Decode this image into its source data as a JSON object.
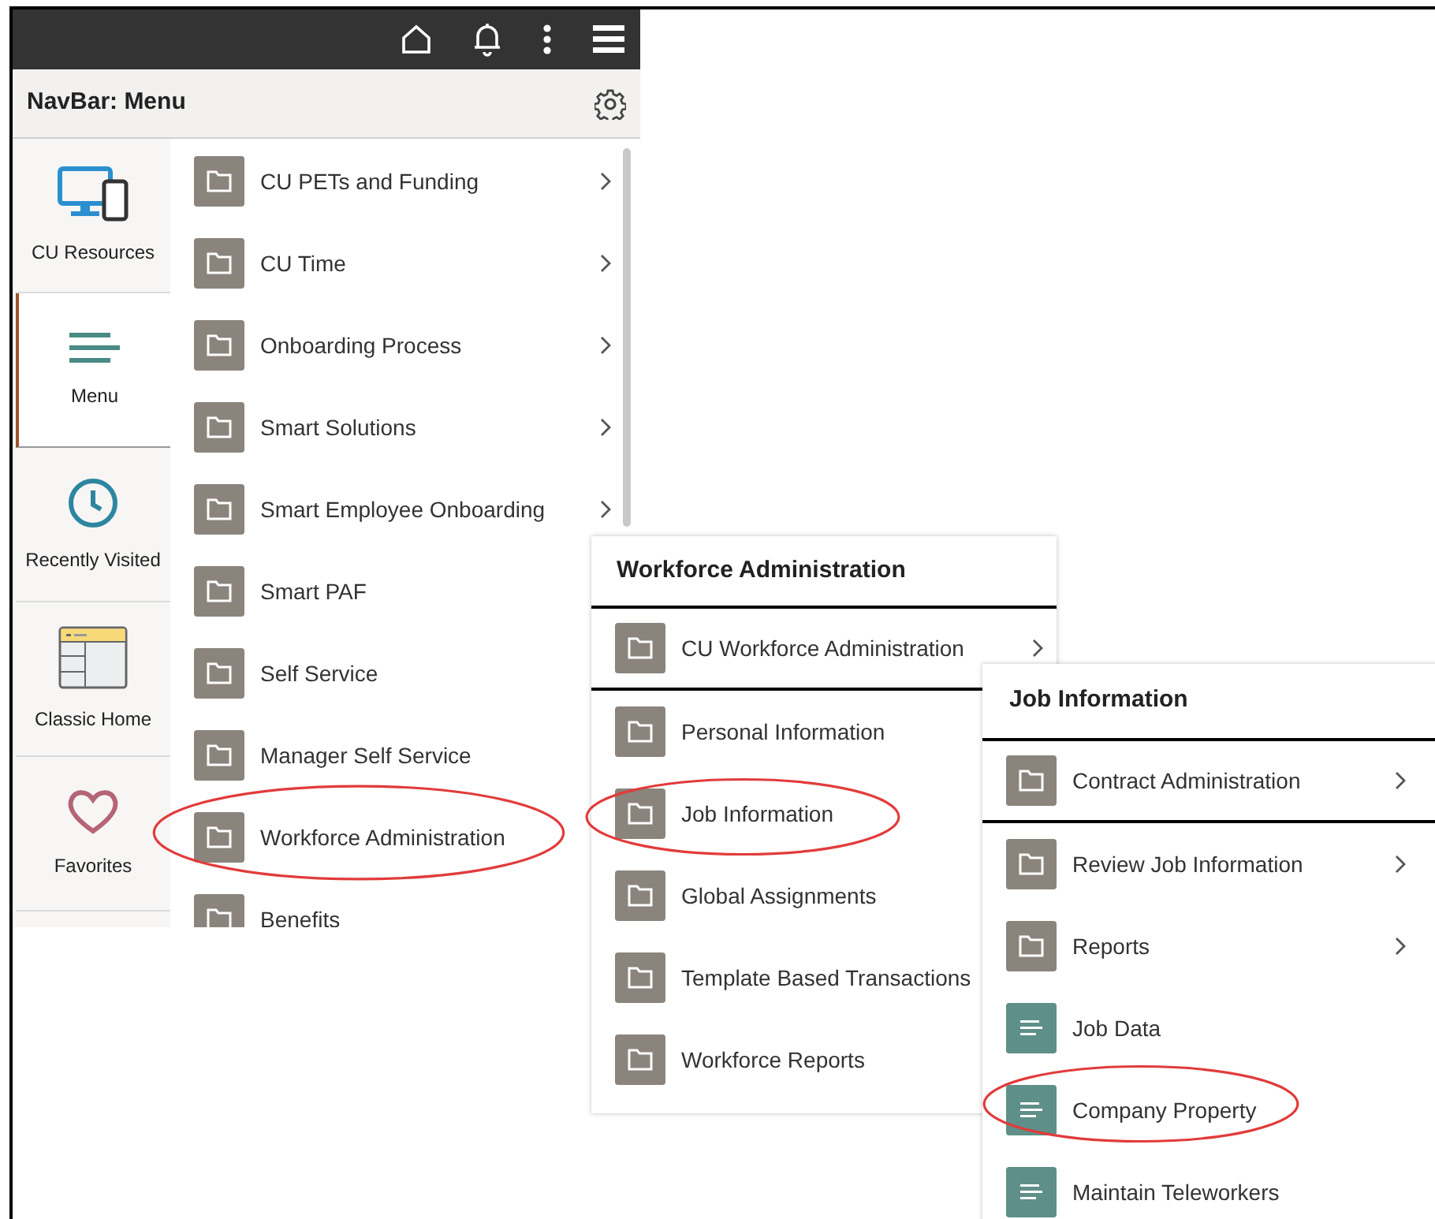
{
  "navbar": {
    "title": "NavBar: Menu"
  },
  "nav_tiles": [
    {
      "label": "CU Resources",
      "selected": false
    },
    {
      "label": "Menu",
      "selected": true
    },
    {
      "label": "Recently Visited",
      "selected": false
    },
    {
      "label": "Classic Home",
      "selected": false
    },
    {
      "label": "Favorites",
      "selected": false
    }
  ],
  "menu": {
    "items": [
      {
        "label": "CU PETs and Funding",
        "kind": "folder",
        "submenu": true,
        "circled": false
      },
      {
        "label": "CU Time",
        "kind": "folder",
        "submenu": true,
        "circled": false
      },
      {
        "label": "Onboarding Process",
        "kind": "folder",
        "submenu": true,
        "circled": false
      },
      {
        "label": "Smart Solutions",
        "kind": "folder",
        "submenu": true,
        "circled": false
      },
      {
        "label": "Smart Employee Onboarding",
        "kind": "folder",
        "submenu": true,
        "circled": false
      },
      {
        "label": "Smart PAF",
        "kind": "folder",
        "circled": false
      },
      {
        "label": "Self Service",
        "kind": "folder",
        "circled": false
      },
      {
        "label": "Manager Self Service",
        "kind": "folder",
        "circled": false
      },
      {
        "label": "Workforce Administration",
        "kind": "folder",
        "circled": true
      },
      {
        "label": "Benefits",
        "kind": "folder",
        "circled": false
      }
    ]
  },
  "submenu_1": {
    "title": "Workforce Administration",
    "items": [
      {
        "label": "CU Workforce Administration",
        "kind": "folder",
        "submenu": true,
        "circled": false,
        "focused": true
      },
      {
        "label": "Personal Information",
        "kind": "folder",
        "circled": false,
        "focused": false
      },
      {
        "label": "Job Information",
        "kind": "folder",
        "circled": true,
        "focused": false
      },
      {
        "label": "Global Assignments",
        "kind": "folder",
        "circled": false,
        "focused": false
      },
      {
        "label": "Template Based Transactions",
        "kind": "folder",
        "circled": false,
        "focused": false
      },
      {
        "label": "Workforce Reports",
        "kind": "folder",
        "circled": false,
        "focused": false
      }
    ]
  },
  "submenu_2": {
    "title": "Job Information",
    "items": [
      {
        "label": "Contract Administration",
        "kind": "folder",
        "submenu": true,
        "circled": false,
        "focused": true
      },
      {
        "label": "Review Job Information",
        "kind": "folder",
        "submenu": true,
        "circled": false,
        "focused": false
      },
      {
        "label": "Reports",
        "kind": "folder",
        "submenu": true,
        "circled": false,
        "focused": false
      },
      {
        "label": "Job Data",
        "kind": "page",
        "submenu": false,
        "circled": false,
        "focused": false
      },
      {
        "label": "Company Property",
        "kind": "page",
        "submenu": false,
        "circled": true,
        "focused": false
      },
      {
        "label": "Maintain Teleworkers",
        "kind": "page",
        "submenu": false,
        "circled": false,
        "focused": false
      }
    ]
  }
}
